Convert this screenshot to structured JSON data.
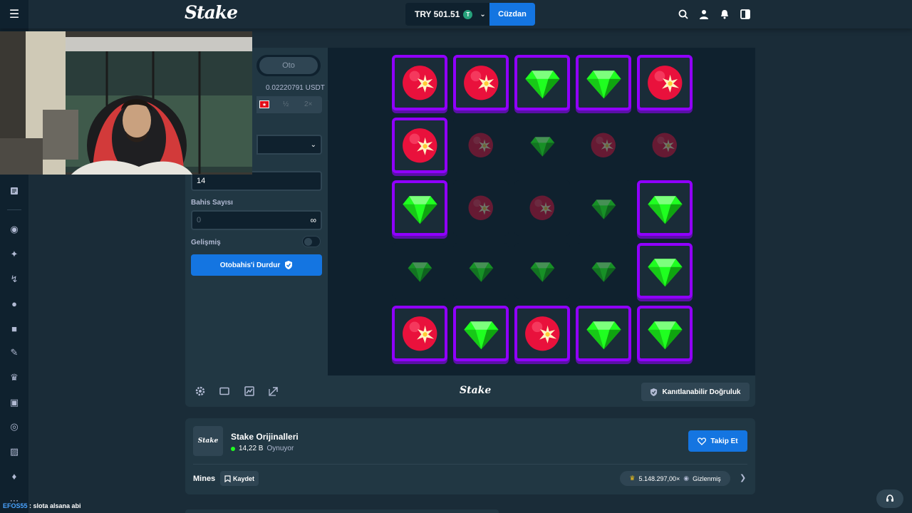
{
  "header": {
    "logo": "Stake",
    "balance": "TRY 501.51",
    "coin": "T",
    "wallet_button": "Cüzdan",
    "icons": [
      "search-icon",
      "user-icon",
      "bell-icon",
      "sidebar-toggle-icon"
    ]
  },
  "sidebar": {
    "icons": [
      "menu-icon",
      "article-icon",
      "casino-chip-icon",
      "sparkle-icon",
      "sports-icon",
      "fire-icon",
      "shirt-icon",
      "pen-icon",
      "crown-icon",
      "badge-icon",
      "lifebuoy-icon",
      "gift-icon",
      "tickets-icon",
      "more-icon"
    ]
  },
  "panel": {
    "tab_auto": "Oto",
    "usdt_value": "0.02220791 USDT",
    "half": "½",
    "double": "2×",
    "mines_count": "14",
    "bet_count_label": "Bahis Sayısı",
    "bet_count_value": "0",
    "infinity": "∞",
    "advanced_label": "Gelişmiş",
    "stop_button": "Otobahis'i Durdur"
  },
  "board": {
    "tiles": [
      {
        "kind": "mine",
        "revealed": true
      },
      {
        "kind": "mine",
        "revealed": true
      },
      {
        "kind": "gem",
        "revealed": true
      },
      {
        "kind": "gem",
        "revealed": true
      },
      {
        "kind": "mine",
        "revealed": true
      },
      {
        "kind": "mine",
        "revealed": true
      },
      {
        "kind": "mine",
        "revealed": false
      },
      {
        "kind": "gem",
        "revealed": false
      },
      {
        "kind": "mine",
        "revealed": false
      },
      {
        "kind": "mine",
        "revealed": false
      },
      {
        "kind": "gem",
        "revealed": true
      },
      {
        "kind": "mine",
        "revealed": false
      },
      {
        "kind": "mine",
        "revealed": false
      },
      {
        "kind": "gem",
        "revealed": false
      },
      {
        "kind": "gem",
        "revealed": true
      },
      {
        "kind": "gem",
        "revealed": false
      },
      {
        "kind": "gem",
        "revealed": false
      },
      {
        "kind": "gem",
        "revealed": false
      },
      {
        "kind": "gem",
        "revealed": false
      },
      {
        "kind": "gem",
        "revealed": true
      },
      {
        "kind": "mine",
        "revealed": true
      },
      {
        "kind": "gem",
        "revealed": true
      },
      {
        "kind": "mine",
        "revealed": true
      },
      {
        "kind": "gem",
        "revealed": true
      },
      {
        "kind": "gem",
        "revealed": true
      }
    ],
    "colors": {
      "purple": "#9000ff",
      "gem": "#1fff20",
      "mine": "#e9113c"
    }
  },
  "footer": {
    "logo": "Stake",
    "fair_button": "Kanıtlanabilir Doğruluk"
  },
  "info": {
    "logo": "Stake",
    "title": "Stake Orijinalleri",
    "players": "14,22 B",
    "playing": "Oynuyor",
    "follow_button": "Takip Et",
    "game_name": "Mines",
    "save_button": "Kaydet",
    "record": "5.148.297,00×",
    "hidden": "Gizlenmiş"
  },
  "chat": {
    "user": "EFOS55",
    "message": " : slota alsana abi"
  }
}
